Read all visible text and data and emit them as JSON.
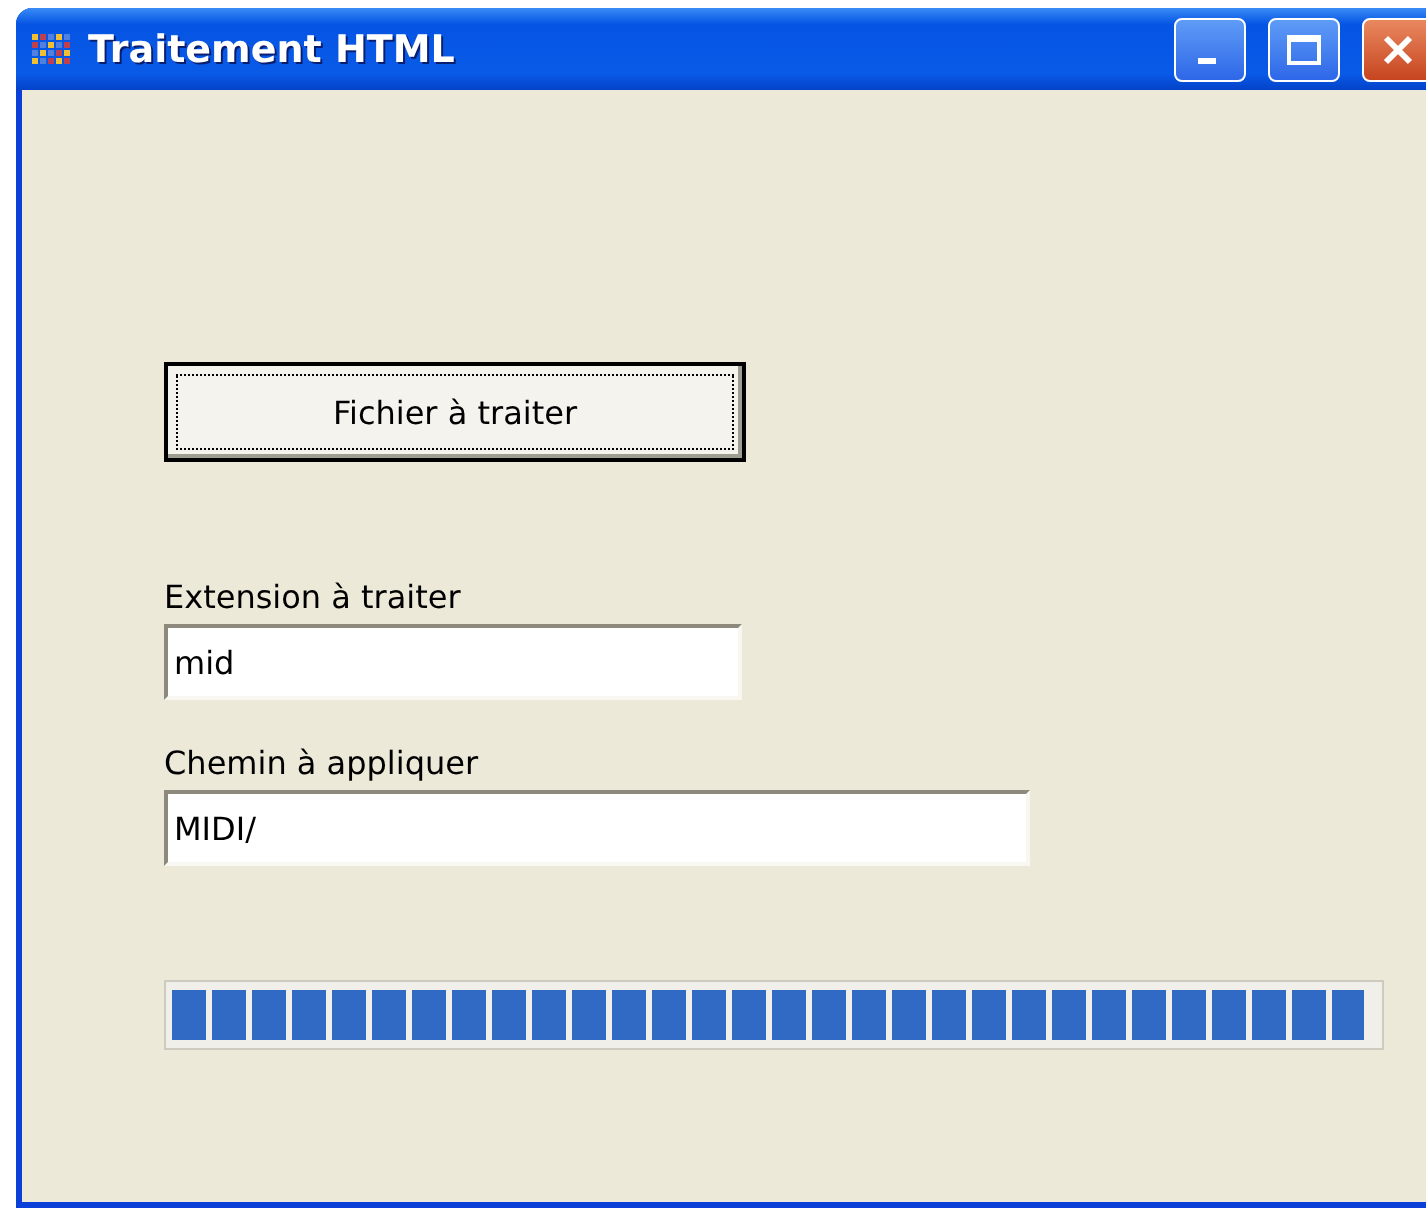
{
  "window": {
    "title": "Traitement HTML"
  },
  "button": {
    "label": "Fichier à traiter",
    "focused": true
  },
  "fields": [
    {
      "label": "Extension à traiter",
      "value": "mid",
      "wide": false
    },
    {
      "label": "Chemin à appliquer",
      "value": "MIDI/",
      "wide": true
    }
  ],
  "progress": {
    "level": 0.99
  }
}
